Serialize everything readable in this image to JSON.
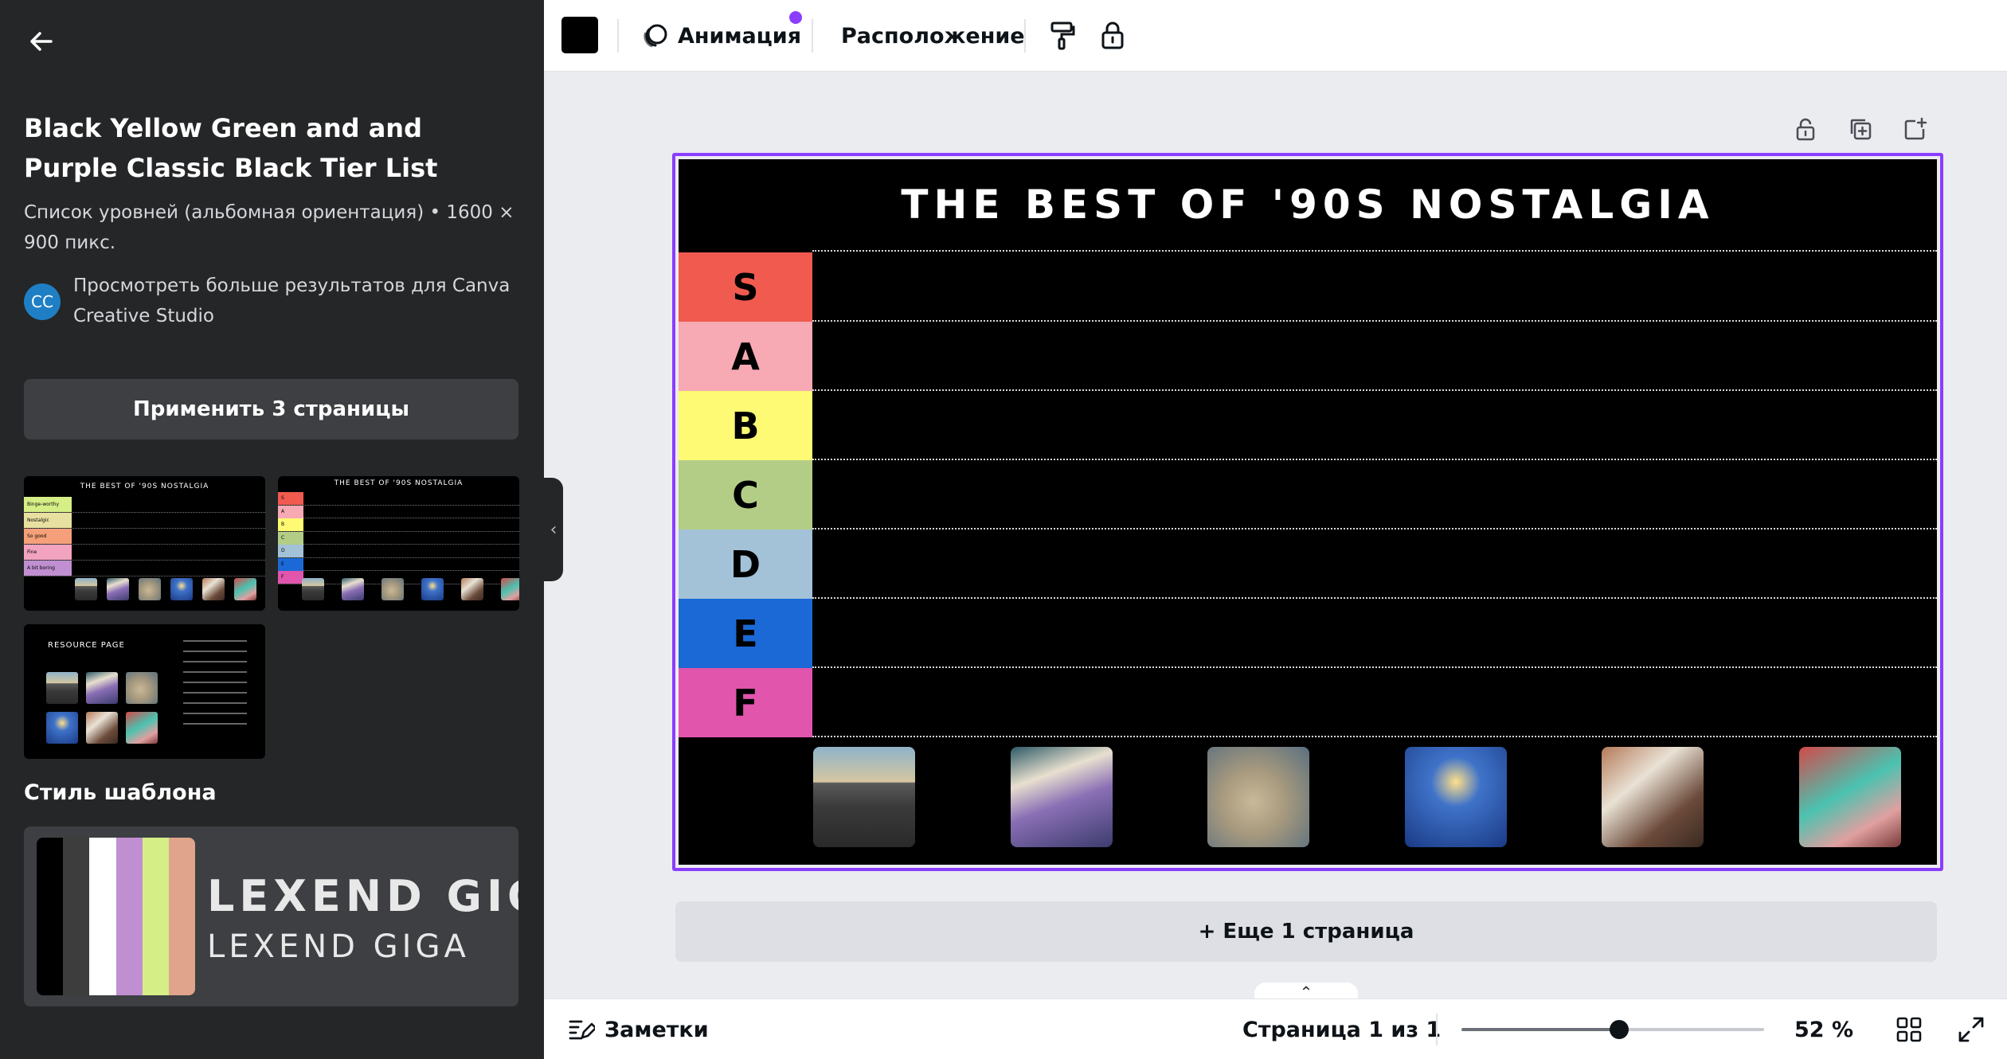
{
  "panel": {
    "template_title": "Black Yellow Green and and Purple Classic Black Tier List",
    "template_meta": "Список уровней (альбомная ориентация) • 1600 × 900 пикс.",
    "creator_initials": "CC",
    "creator_link": "Просмотреть больше результатов для Canva Creative Studio",
    "apply_button": "Применить 3 страницы",
    "thumbnails": {
      "thumb1_title": "THE BEST OF '90S NOSTALGIA",
      "thumb1_labels": [
        "Binge-worthy",
        "Nostalgic",
        "So good",
        "Fine",
        "A bit boring"
      ],
      "thumb2_title": "THE BEST OF '90S NOSTALGIA",
      "thumb2_labels": [
        "S",
        "A",
        "B",
        "C",
        "D",
        "E",
        "F"
      ],
      "thumb3_title": "RESOURCE PAGE"
    },
    "style_label": "Стиль шаблона",
    "style_font_primary": "LEXEND GIGA",
    "style_font_secondary": "LEXEND GIGA",
    "style_palette": [
      "#000000",
      "#3d3d3d",
      "#ffffff",
      "#c08fd1",
      "#d6ee86",
      "#e0a48c"
    ]
  },
  "toolbar": {
    "color_value": "#000000",
    "animation_label": "Анимация",
    "position_label": "Расположение"
  },
  "slide": {
    "title": "THE BEST OF '90S NOSTALGIA",
    "tiers": [
      {
        "label": "S",
        "color": "#f05a4f"
      },
      {
        "label": "A",
        "color": "#f7a9b4"
      },
      {
        "label": "B",
        "color": "#fefa73"
      },
      {
        "label": "C",
        "color": "#b3cd87"
      },
      {
        "label": "D",
        "color": "#a3c2d7"
      },
      {
        "label": "E",
        "color": "#1b69d6"
      },
      {
        "label": "F",
        "color": "#e155ad"
      }
    ],
    "items": [
      "boombox",
      "floppy-disks",
      "game-controller",
      "arcade-cabinet",
      "polaroid-photos",
      "handheld-console"
    ]
  },
  "more_pages": "+ Еще 1 страница",
  "bottombar": {
    "notes_label": "Заметки",
    "page_indicator": "Страница 1 из 1",
    "zoom_percent": 52,
    "zoom_label": "52 %"
  },
  "accent_color": "#8b3dff"
}
